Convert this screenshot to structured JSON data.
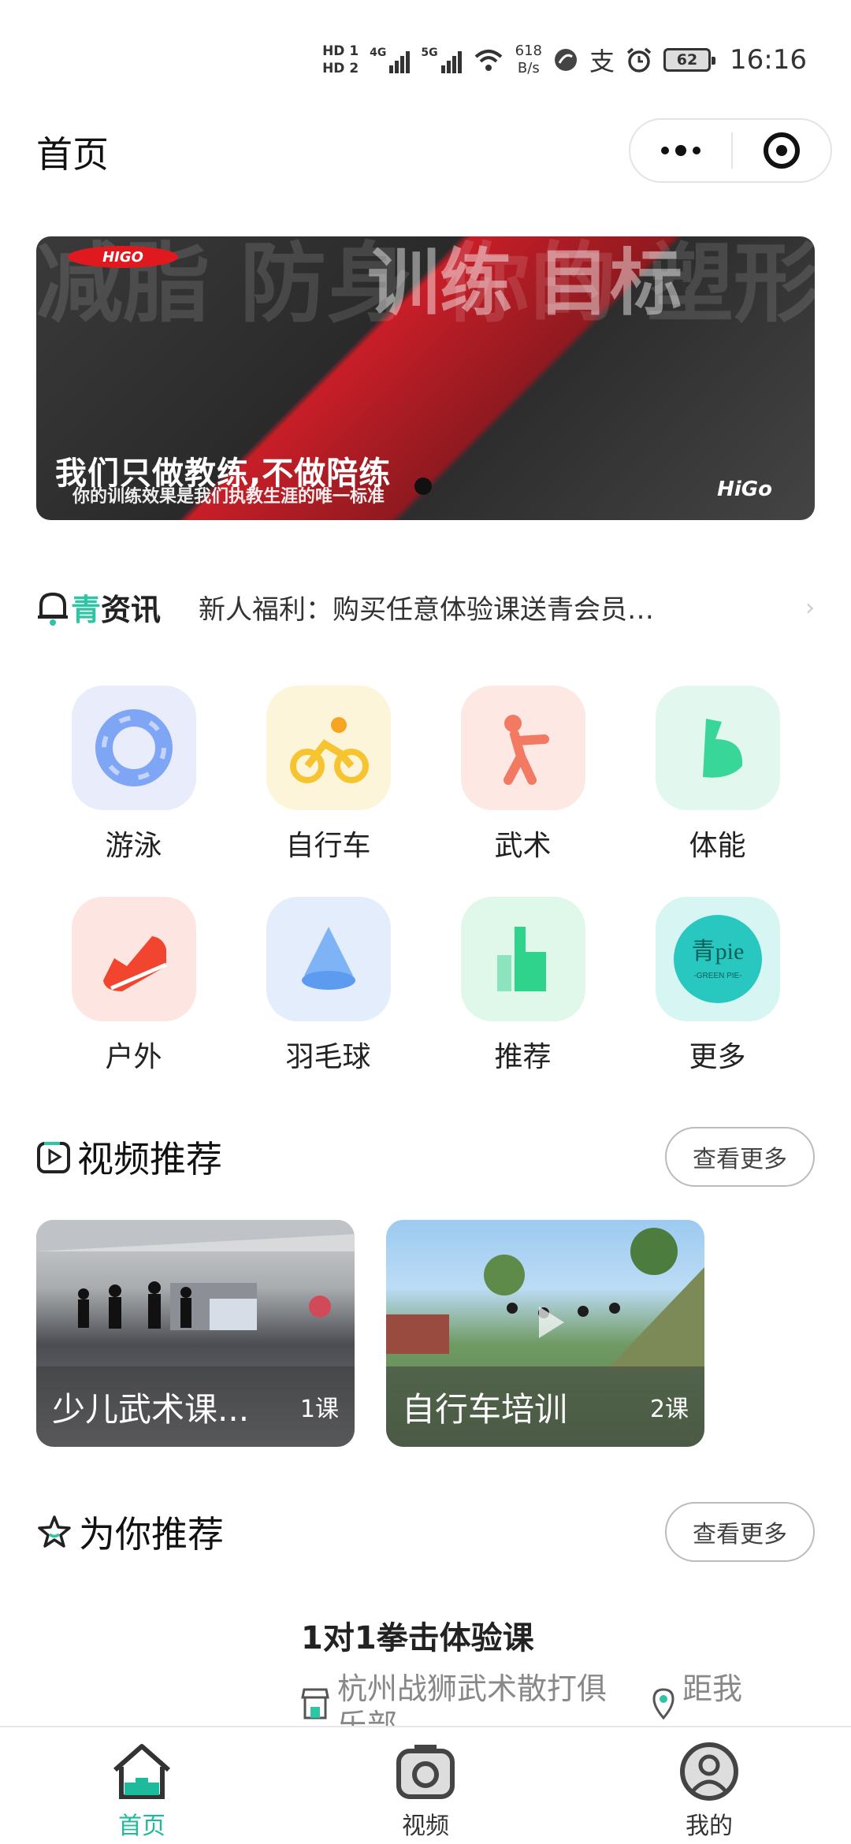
{
  "status_bar": {
    "hd1": "HD 1",
    "hd2": "HD 2",
    "net1": "4G",
    "net2": "5G",
    "speed_value": "618",
    "speed_unit": "B/s",
    "battery": "62",
    "time": "16:16"
  },
  "header": {
    "title": "首页"
  },
  "banner": {
    "logo": "HIGO",
    "bg_words": "减脂 防身 你的 塑形",
    "bg_words2": "训练 目标",
    "slogan": "我们只做教练,不做陪练",
    "subtitle": "你的训练效果是我们执教生涯的唯一标准",
    "brand": "HiGo"
  },
  "news": {
    "label_accent": "青",
    "label_rest": "资讯",
    "text": "新人福利：购买任意体验课送青会员…"
  },
  "categories": [
    {
      "label": "游泳",
      "icon": "swim-ring-icon",
      "color": "#7fa6f5"
    },
    {
      "label": "自行车",
      "icon": "bicycle-icon",
      "color": "#f6c431"
    },
    {
      "label": "武术",
      "icon": "martial-arts-icon",
      "color": "#f27a63"
    },
    {
      "label": "体能",
      "icon": "muscle-icon",
      "color": "#39d69a"
    },
    {
      "label": "户外",
      "icon": "sneaker-icon",
      "color": "#f2452f"
    },
    {
      "label": "羽毛球",
      "icon": "shuttlecock-icon",
      "color": "#5c9bf0"
    },
    {
      "label": "推荐",
      "icon": "thumbs-up-icon",
      "color": "#2fd38c"
    },
    {
      "label": "更多",
      "icon": "greenpie-logo-icon",
      "color": "#28c7c0"
    }
  ],
  "video_section": {
    "title": "视频推荐",
    "more": "查看更多",
    "videos": [
      {
        "name": "少儿武术课...",
        "count": "1课"
      },
      {
        "name": "自行车培训",
        "count": "2课"
      }
    ]
  },
  "recommend_section": {
    "title": "为你推荐",
    "more": "查看更多",
    "item": {
      "title": "1对1拳击体验课",
      "venue": "杭州战狮武术散打俱乐部",
      "distance": "距我"
    }
  },
  "tabbar": [
    {
      "label": "首页",
      "active": true
    },
    {
      "label": "视频",
      "active": false
    },
    {
      "label": "我的",
      "active": false
    }
  ]
}
